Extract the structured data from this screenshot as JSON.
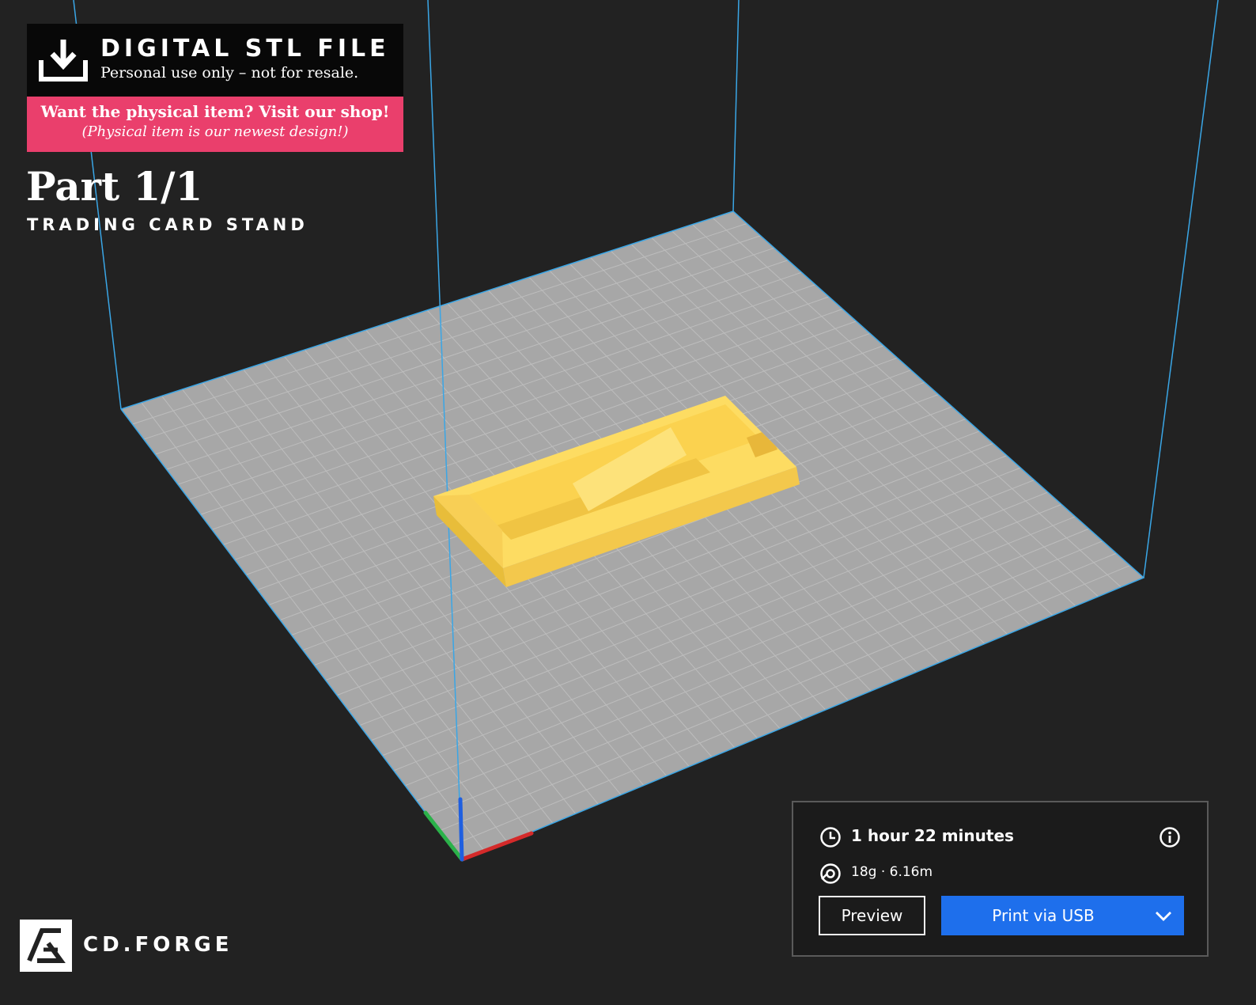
{
  "banner": {
    "title": "DIGITAL STL FILE",
    "subtitle": "Personal use only – not for resale.",
    "shop_cta": "Want the physical item? Visit our shop!",
    "shop_note": "(Physical item is our newest design!)",
    "icon": "download-icon"
  },
  "part": {
    "title": "Part 1/1",
    "subtitle": "TRADING CARD STAND"
  },
  "brand": {
    "logo_text": "CD.FORGE",
    "icon": "cd-forge-logo-icon"
  },
  "print_panel": {
    "time": "1 hour 22 minutes",
    "material": "18g · 6.16m",
    "preview_label": "Preview",
    "print_label": "Print via USB",
    "icons": [
      "clock-icon",
      "info-icon",
      "filament-spool-icon",
      "chevron-down-icon"
    ]
  },
  "colors": {
    "background": "#222222",
    "build_plate": "#a7a7a7",
    "build_volume_edges": "#3aa6e6",
    "model": "#fddc62",
    "banner_pink": "#ea3f6c",
    "print_button": "#1e6fec",
    "axis_x": "#d42a2a",
    "axis_y": "#2bb24a",
    "axis_z": "#1f5fe0"
  }
}
